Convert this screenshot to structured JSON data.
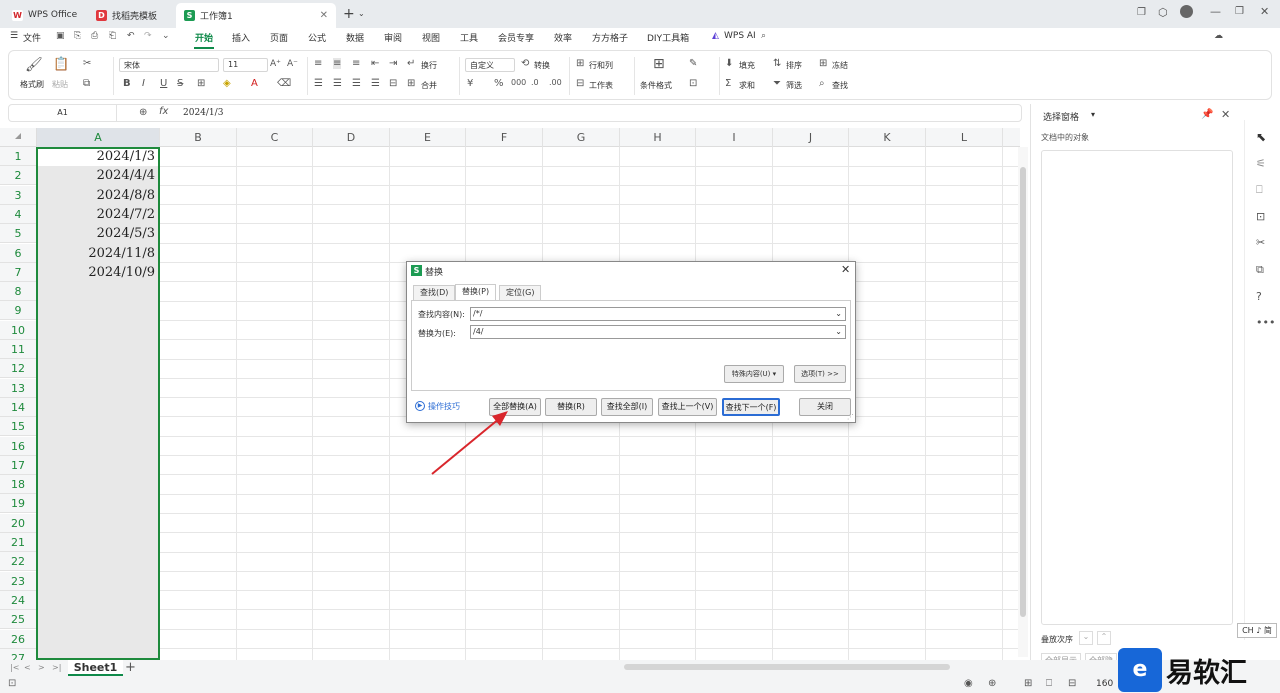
{
  "tabs": [
    {
      "label": "WPS Office",
      "icon": "W"
    },
    {
      "label": "找稻壳模板",
      "icon": "D"
    },
    {
      "label": "工作簿1",
      "icon": "S"
    }
  ],
  "menu": {
    "file": "文件",
    "items": [
      "开始",
      "插入",
      "页面",
      "公式",
      "数据",
      "审阅",
      "视图",
      "工具",
      "会员专享",
      "效率",
      "方方格子",
      "DIY工具箱",
      "WPS AI"
    ],
    "share": "分享"
  },
  "ribbon": {
    "format_painter": "格式刷",
    "paste": "粘贴",
    "font_name": "宋体",
    "font_size": "11",
    "wrap": "换行",
    "merge": "合并",
    "number_format": "自定义",
    "convert": "转换",
    "rows_cols": "行和列",
    "worksheet": "工作表",
    "cond_format": "条件格式",
    "fill": "填充",
    "sort": "排序",
    "freeze": "冻结",
    "sum": "求和",
    "filter": "筛选",
    "find": "查找"
  },
  "formula_bar": {
    "cell_ref": "A1",
    "fx": "fx",
    "value": "2024/1/3"
  },
  "columns": [
    "A",
    "B",
    "C",
    "D",
    "E",
    "F",
    "G",
    "H",
    "I",
    "J",
    "K",
    "L"
  ],
  "rows": [
    "1",
    "2",
    "3",
    "4",
    "5",
    "6",
    "7",
    "8",
    "9",
    "10",
    "11",
    "12",
    "13",
    "14",
    "15",
    "16",
    "17",
    "18",
    "19",
    "20",
    "21",
    "22",
    "23",
    "24",
    "25",
    "26",
    "27"
  ],
  "cells_a": [
    "2024/1/3",
    "2024/4/4",
    "2024/8/8",
    "2024/7/2",
    "2024/5/3",
    "2024/11/8",
    "2024/10/9"
  ],
  "sheet_tab": "Sheet1",
  "side_panel": {
    "title": "选择窗格",
    "subtitle": "文档中的对象",
    "stack_order": "叠放次序",
    "show_all": "全部显示",
    "hide_all": "全部隐"
  },
  "dialog": {
    "title": "替换",
    "tabs": [
      "查找(D)",
      "替换(P)",
      "定位(G)"
    ],
    "find_label": "查找内容(N):",
    "find_value": "/*/",
    "replace_label": "替换为(E):",
    "replace_value": "/4/",
    "special_btn": "特殊内容(U) ▾",
    "options_btn": "选项(T) >>",
    "tips_link": "操作技巧",
    "buttons": [
      "全部替换(A)",
      "替换(R)",
      "查找全部(I)",
      "查找上一个(V)",
      "查找下一个(F)",
      "关闭"
    ]
  },
  "statusbar": {
    "zoom": "160",
    "ime": "CH ♪ 简"
  },
  "watermark": "易软汇",
  "colors": {
    "accent": "#0f8a4a",
    "arrow": "#d9262c",
    "link": "#2b6cd4"
  }
}
